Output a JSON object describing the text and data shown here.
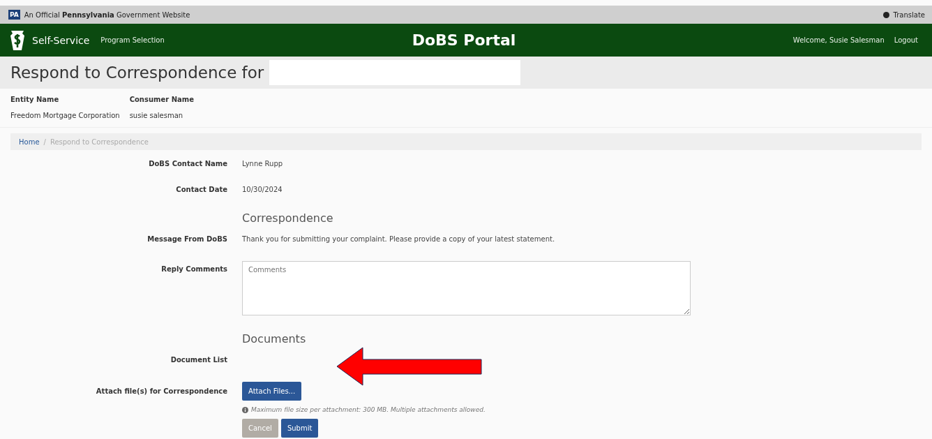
{
  "gov_bar": {
    "badge": "PA",
    "text": "An Official **Pennsylvania** Government Website",
    "translate": "Translate"
  },
  "header": {
    "brand": "Self-Service",
    "nav": "Program Selection",
    "title": "DoBS Portal",
    "welcome": "Welcome, Susie Salesman",
    "logout": "Logout"
  },
  "page_title": "Respond to Correspondence for",
  "summary": [
    {
      "label": "Entity Name",
      "value": "Freedom Mortgage Corporation"
    },
    {
      "label": "Consumer Name",
      "value": "susie salesman"
    }
  ],
  "breadcrumb": [
    {
      "label": "Home",
      "link": true
    },
    {
      "separator": "/",
      "label": "Respond to Correspondence",
      "link": false
    }
  ],
  "form": [
    {
      "kind": "text",
      "label": "DoBS Contact Name",
      "value": "Lynne Rupp"
    },
    {
      "kind": "text",
      "label": "Contact Date",
      "value": "10/30/2024"
    },
    {
      "kind": "heading",
      "value": "Correspondence"
    },
    {
      "kind": "text",
      "label": "Message From DoBS",
      "value": "Thank you for submitting your complaint.  Please provide a copy of your latest statement."
    },
    {
      "kind": "textarea",
      "label": "Reply Comments",
      "placeholder": "Comments"
    },
    {
      "kind": "heading",
      "value": "Documents"
    },
    {
      "kind": "text",
      "label": "Document List"
    },
    {
      "kind": "attach",
      "label": "Attach file(s) for Correspondence",
      "button": "Attach Files...",
      "hint": "Maximum file size per attachment: 300 MB. Multiple attachments allowed."
    }
  ],
  "buttons": [
    {
      "label": "Cancel",
      "kind": "secondary"
    },
    {
      "label": "Submit",
      "kind": "primary"
    }
  ]
}
